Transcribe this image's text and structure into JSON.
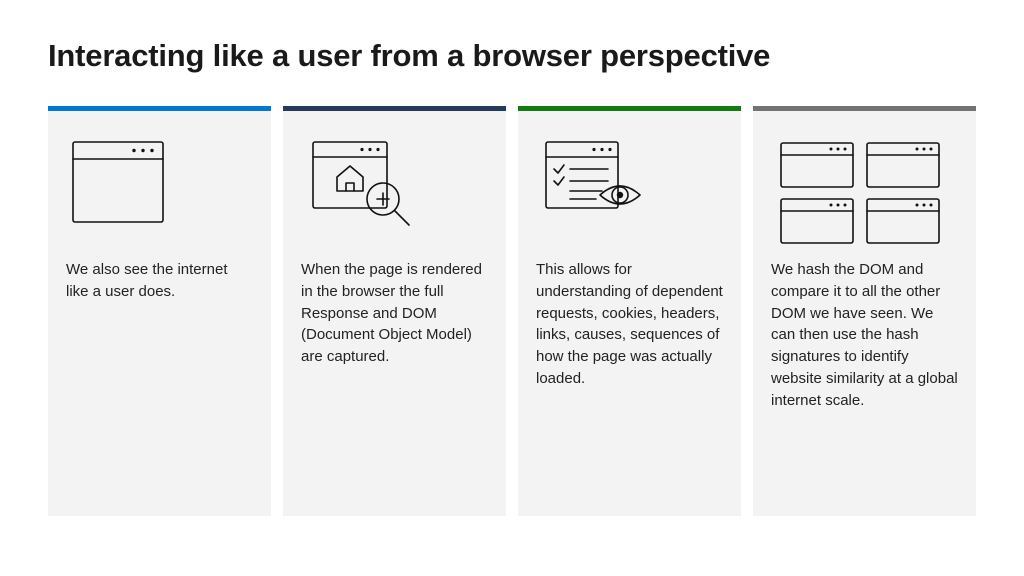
{
  "title": "Interacting like a user from a browser perspective",
  "colors": {
    "c1": "#0078d4",
    "c2": "#243a5e",
    "c3": "#107c10",
    "c4": "#737373"
  },
  "cards": [
    {
      "text": "We also see the internet like a user does."
    },
    {
      "text": "When the page is rendered in the browser the full Response and DOM (Document Object Model) are captured."
    },
    {
      "text": "This allows for understanding of dependent requests, cookies, headers, links, causes, sequences of how the page was actually loaded."
    },
    {
      "text": "We hash the DOM and compare it to all the other DOM we have seen. We can then use the hash signatures to identify website similarity at a global internet scale."
    }
  ]
}
